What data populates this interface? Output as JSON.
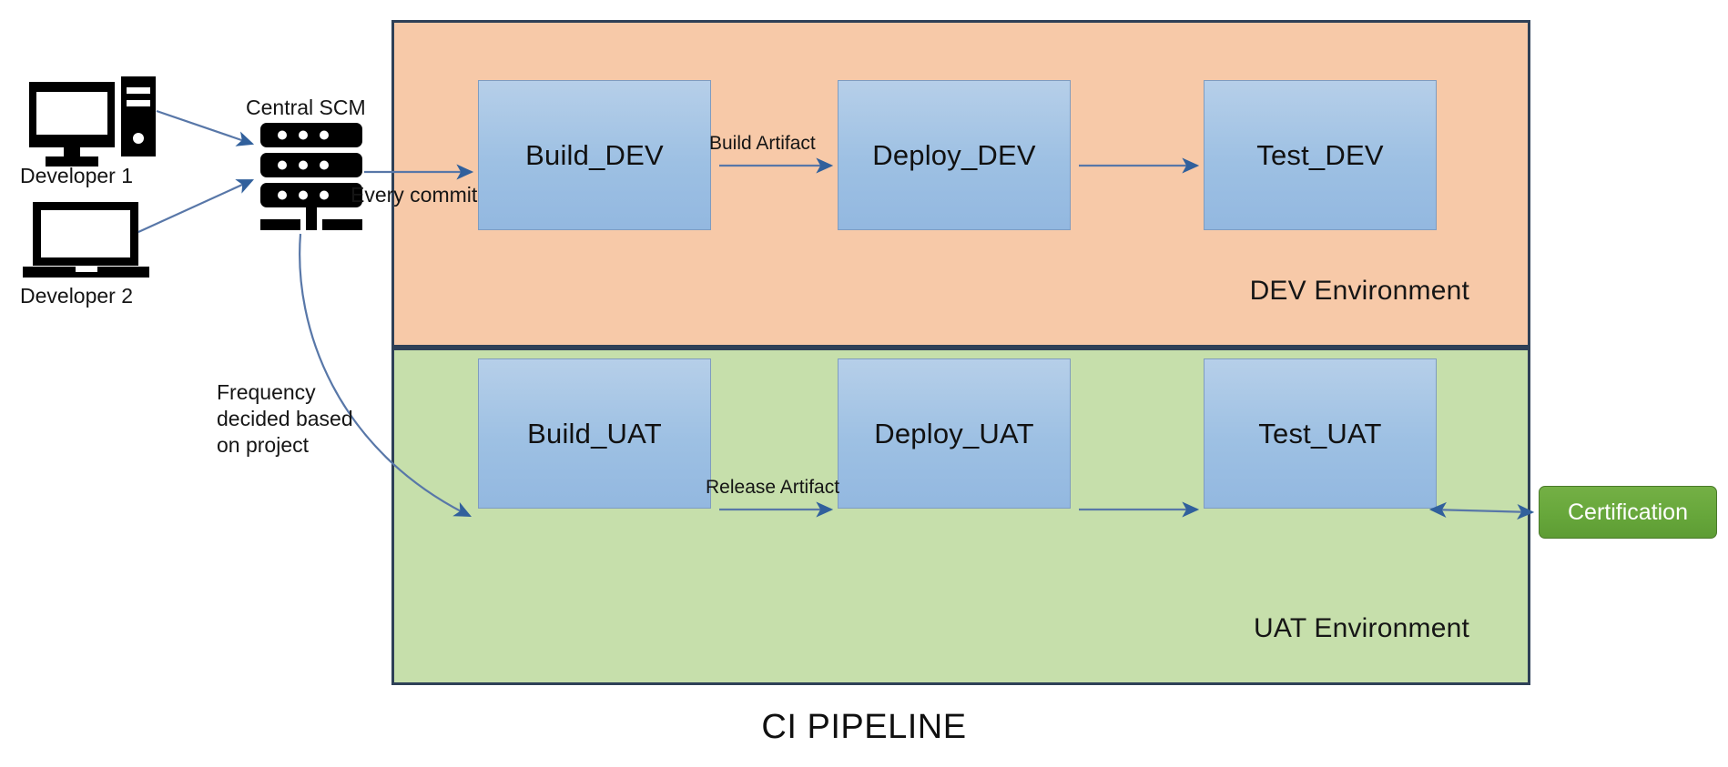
{
  "diagram": {
    "title": "CI PIPELINE",
    "type": "ci-cd-pipeline-flow-diagram"
  },
  "actors": [
    {
      "id": "developer-1",
      "label": "Developer 1",
      "icon": "desktop-computer-icon"
    },
    {
      "id": "developer-2",
      "label": "Developer 2",
      "icon": "laptop-icon"
    }
  ],
  "scm": {
    "label": "Central SCM",
    "icon": "server-rack-icon"
  },
  "environments": [
    {
      "id": "dev",
      "label": "DEV Environment",
      "color": "#f7c9a8",
      "border_color": "#2e4057",
      "stages": [
        {
          "id": "build-dev",
          "label": "Build_DEV"
        },
        {
          "id": "deploy-dev",
          "label": "Deploy_DEV"
        },
        {
          "id": "test-dev",
          "label": "Test_DEV"
        }
      ]
    },
    {
      "id": "uat",
      "label": "UAT Environment",
      "color": "#c6dfab",
      "border_color": "#2e4057",
      "stages": [
        {
          "id": "build-uat",
          "label": "Build_UAT"
        },
        {
          "id": "deploy-uat",
          "label": "Deploy_UAT"
        },
        {
          "id": "test-uat",
          "label": "Test_UAT"
        }
      ]
    }
  ],
  "certification": {
    "label": "Certification",
    "color": "#66a63a",
    "text_color": "#ffffff"
  },
  "connector_labels": {
    "every_commit": "Every commit",
    "frequency": "Frequency decided based on project",
    "build_artifact": "Build Artifact",
    "release_artifact": "Release Artifact"
  },
  "colors": {
    "stage_fill": "#9dc0e3",
    "stage_border": "#7f9cc0",
    "arrow": "#5877a8",
    "arrow_head": "#31609c",
    "dev_background": "#f7c9a8",
    "uat_background": "#c6dfab",
    "certification_fill": "#66a63a",
    "container_border": "#2e4057",
    "text": "#151515"
  }
}
